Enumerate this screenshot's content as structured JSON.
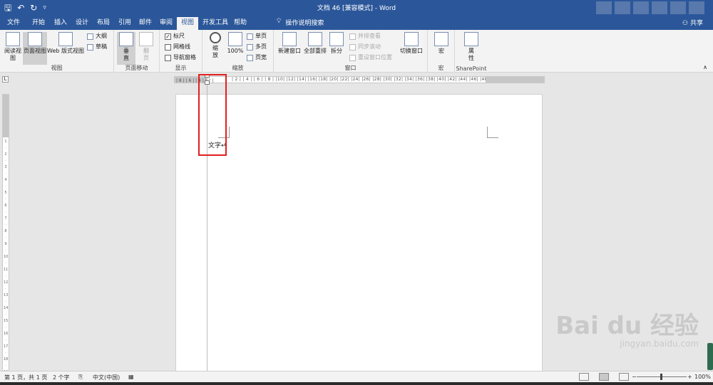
{
  "titlebar": {
    "title": "文档 46 [兼容模式] - Word",
    "qat": [
      "save-icon",
      "undo-icon",
      "redo-icon",
      "customize-icon"
    ]
  },
  "tabs": [
    "文件",
    "开始",
    "插入",
    "设计",
    "布局",
    "引用",
    "邮件",
    "审阅",
    "视图",
    "开发工具",
    "帮助"
  ],
  "active_tab": "视图",
  "tell_me": "操作说明搜索",
  "share": "共享",
  "ribbon": {
    "views": {
      "label": "视图",
      "read_mode": "阅读视图",
      "print_layout": "页面视图",
      "web_layout": "Web 版式视图",
      "outline": "大纲",
      "draft": "草稿"
    },
    "page_movement": {
      "label": "页面移动",
      "vertical": "垂直",
      "side_to_side": "翻页"
    },
    "show": {
      "label": "显示",
      "ruler": "标尺",
      "ruler_checked": true,
      "gridlines": "网格线",
      "nav_pane": "导航窗格"
    },
    "zoom": {
      "label": "缩放",
      "zoom": "缩放",
      "hundred": "100%",
      "one_page": "单页",
      "multi_page": "多页",
      "page_width": "页宽"
    },
    "window": {
      "label": "窗口",
      "new_window": "新建窗口",
      "arrange_all": "全部重排",
      "split": "拆分",
      "side_by_side": "并排查看",
      "sync_scroll": "同步滚动",
      "reset_position": "重设窗口位置",
      "switch_windows": "切换窗口"
    },
    "macros": {
      "label": "宏",
      "macros": "宏"
    },
    "sharepoint": {
      "label": "SharePoint",
      "properties": "属性"
    }
  },
  "ruler": {
    "ticks": "| 2 |  | 4 |  | 6 |  | 8 |  |10|  |12|  |14|  |16|  |18|  |20|  |22|  |24|  |26|  |28|  |30|  |32|  |34|  |36|  |38|  |40|  |42|  |44|  |46|  |48",
    "left_ticks": "| 8 | | 6 | | 4 | | 2 |"
  },
  "document": {
    "text": "文字↵"
  },
  "statusbar": {
    "page": "第 1 页，共 1 页",
    "words": "2 个字",
    "language": "中文(中国)",
    "zoom": "100%"
  },
  "watermark": {
    "brand": "Bai du 经验",
    "url": "jingyan.baidu.com"
  }
}
